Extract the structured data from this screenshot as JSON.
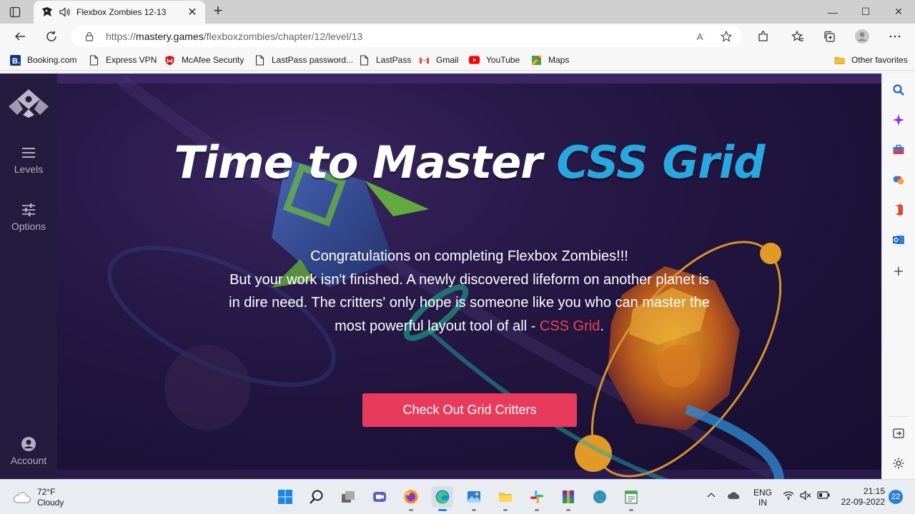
{
  "browser": {
    "tab": {
      "title": "Flexbox Zombies 12-13",
      "close": "✕"
    },
    "new_tab": "+",
    "window_controls": {
      "minimize": "—",
      "maximize": "☐",
      "close": "✕"
    },
    "url": {
      "scheme": "https://",
      "host": "mastery.games",
      "path": "/flexboxzombies/chapter/12/level/13"
    },
    "favorites": [
      {
        "label": "Booking.com",
        "icon": "booking-icon"
      },
      {
        "label": "Express VPN",
        "icon": "page-icon"
      },
      {
        "label": "McAfee Security",
        "icon": "mcafee-icon"
      },
      {
        "label": "LastPass password...",
        "icon": "page-icon"
      },
      {
        "label": "LastPass",
        "icon": "page-icon"
      },
      {
        "label": "Gmail",
        "icon": "gmail-icon"
      },
      {
        "label": "YouTube",
        "icon": "youtube-icon"
      },
      {
        "label": "Maps",
        "icon": "maps-icon"
      }
    ],
    "other_favorites": "Other favorites"
  },
  "sidebar": {
    "levels": "Levels",
    "options": "Options",
    "account": "Account"
  },
  "hero": {
    "title_main": "Time to Master ",
    "title_accent": "CSS Grid",
    "line1": "Congratulations on completing Flexbox Zombies!!!",
    "line2": "But your work isn't finished. A newly discovered lifeform on another planet is in dire need. The critters' only hope is someone like you who can master the most powerful layout tool of all - ",
    "link": "CSS Grid",
    "line_end": ".",
    "cta": "Check Out Grid Critters"
  },
  "taskbar": {
    "weather_temp": "72°F",
    "weather_desc": "Cloudy",
    "lang_1": "ENG",
    "lang_2": "IN",
    "time": "21:15",
    "date": "22-09-2022",
    "notifications": "22"
  },
  "colors": {
    "accent_blue": "#29a8e0",
    "link_red": "#f0454d",
    "cta_pink": "#e83a5a",
    "sidebar_bg": "#251b3f"
  }
}
